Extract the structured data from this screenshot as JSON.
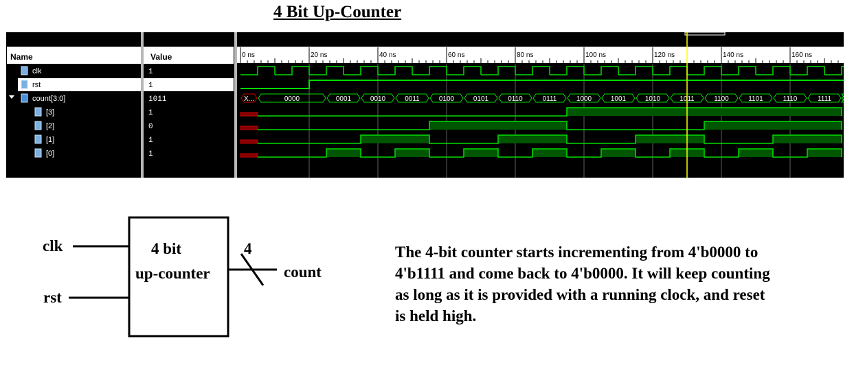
{
  "title": "4 Bit Up-Counter",
  "waveform": {
    "headers": {
      "name": "Name",
      "value": "Value"
    },
    "signals": [
      {
        "name": "clk",
        "value": "1",
        "icon": "signal-icon"
      },
      {
        "name": "rst",
        "value": "1",
        "icon": "signal-icon"
      },
      {
        "name": "count[3:0]",
        "value": "1011",
        "icon": "bus-icon"
      },
      {
        "name": "[3]",
        "value": "1",
        "icon": "signal-icon"
      },
      {
        "name": "[2]",
        "value": "0",
        "icon": "signal-icon"
      },
      {
        "name": "[1]",
        "value": "1",
        "icon": "signal-icon"
      },
      {
        "name": "[0]",
        "value": "1",
        "icon": "signal-icon"
      }
    ],
    "time_labels": [
      "0 ns",
      "20 ns",
      "40 ns",
      "60 ns",
      "80 ns",
      "100 ns",
      "120 ns",
      "140 ns",
      "160 ns"
    ],
    "count_values": [
      "X...",
      "0000",
      "0001",
      "0010",
      "0011",
      "0100",
      "0101",
      "0110",
      "0111",
      "1000",
      "1001",
      "1010",
      "1011",
      "1100",
      "1101",
      "1110",
      "1111"
    ],
    "cursor_time_ns": 130,
    "colors": {
      "wave": "#00dd00",
      "fill": "#005500",
      "unknown": "#cc0000",
      "cursor": "#ffff00",
      "grid": "#606060"
    }
  },
  "block_diagram": {
    "block_line1": "4 bit",
    "block_line2": "up-counter",
    "input_clk": "clk",
    "input_rst": "rst",
    "bus_width": "4",
    "output_count": "count"
  },
  "description_lines": [
    "The 4-bit counter starts incrementing from 4'b0000 to",
    "4'b1111 and come back to 4'b0000. It will keep counting",
    "as long as it is provided with a running clock, and reset",
    "is held high."
  ]
}
